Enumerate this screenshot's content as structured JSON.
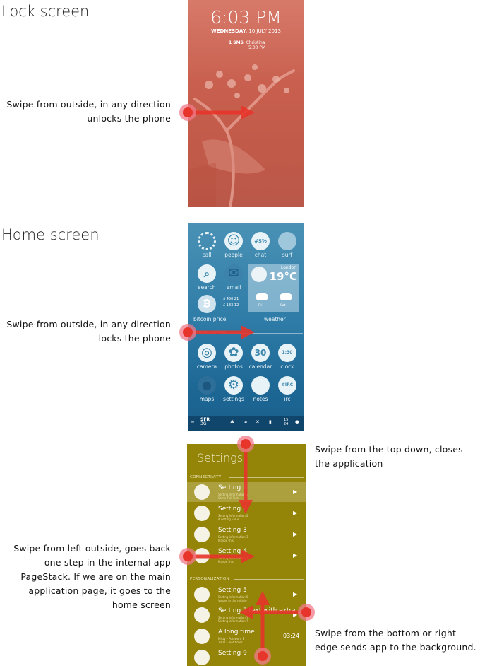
{
  "headings": {
    "lock": "Lock screen",
    "home": "Home screen"
  },
  "notes": {
    "lock": [
      "Swipe from outside, in any direction",
      "unlocks the phone"
    ],
    "home": [
      "Swipe from outside, in any direction",
      "locks the phone"
    ],
    "top": [
      "Swipe from the top down, closes",
      "the application"
    ],
    "left": [
      "Swipe from left outside, goes back",
      "one step in the internal app",
      "PageStack. If we are on the main",
      "application page, it goes to the",
      "home screen"
    ],
    "bottom": [
      "Swipe from the bottom or right",
      "edge sends app to the background."
    ]
  },
  "lock_screen": {
    "time": "6:03 PM",
    "date_day": "WEDNESDAY,",
    "date_rest": " 10 JULY 2013",
    "notification_label": "1 SMS",
    "notification_name": "Christina",
    "notification_time": "5:00 PM"
  },
  "home_screen": {
    "apps_row1": [
      {
        "label": "call",
        "icon": "call-icon",
        "glyph": ""
      },
      {
        "label": "people",
        "icon": "smiley-icon",
        "glyph": "☺"
      },
      {
        "label": "chat",
        "icon": "chat-icon",
        "glyph": "#$%"
      },
      {
        "label": "surf",
        "icon": "globe-icon",
        "glyph": ""
      }
    ],
    "apps_row2": [
      {
        "label": "search",
        "icon": "search-icon",
        "glyph": "⌕"
      },
      {
        "label": "email",
        "icon": "email-icon",
        "glyph": "✉"
      }
    ],
    "bitcoin": {
      "label": "bitcoin price",
      "icon": "bitcoin-icon",
      "glyph": "₿",
      "usd": "$ 450.21",
      "gbp": "£ 133.12"
    },
    "weather": {
      "label": "weather",
      "city": "London",
      "temp": "19°C",
      "day1": "Fri",
      "day2": "Sat"
    },
    "section_label": "PERSONALIZATION",
    "apps_row4": [
      {
        "label": "camera",
        "icon": "camera-icon",
        "glyph": "◎"
      },
      {
        "label": "photos",
        "icon": "flower-icon",
        "glyph": "✿"
      },
      {
        "label": "calendar",
        "icon": "calendar-icon",
        "glyph": "30"
      },
      {
        "label": "clock",
        "icon": "clock-icon",
        "glyph": "1:30"
      }
    ],
    "apps_row5": [
      {
        "label": "maps",
        "icon": "map-pin-icon",
        "glyph": "●"
      },
      {
        "label": "settings",
        "icon": "gear-icon",
        "glyph": "⚙"
      },
      {
        "label": "notes",
        "icon": "notes-icon",
        "glyph": ""
      },
      {
        "label": "irc",
        "icon": "irc-icon",
        "glyph": "#IRC"
      }
    ],
    "status": {
      "carrier": "SFR",
      "carrier_sub": "3G",
      "time": "15",
      "time_sub": "24"
    }
  },
  "settings_app": {
    "title": "Settings",
    "section1": "CONNECTIVITY",
    "section2": "PERSONALIZATION",
    "rows_top": [
      {
        "title": "Setting 1",
        "sub1": "Setting information 1",
        "sub2": "Some Full Text",
        "highlight": true
      },
      {
        "title": "Setting 2",
        "sub1": "Setting information 2",
        "sub2": "A setting value",
        "highlight": false
      },
      {
        "title": "Setting 3",
        "sub1": "Setting information 3",
        "sub2": "Maybe this",
        "highlight": false
      },
      {
        "title": "Setting 4",
        "sub1": "Setting information 4",
        "sub2": "Maybe this",
        "highlight": false
      }
    ],
    "rows_bottom": [
      {
        "title": "Setting 5",
        "sub1": "Setting information 5",
        "sub2": "Values in the middle",
        "right": "▶"
      },
      {
        "title": "Setting 7 text with extra",
        "sub1": "Setting information 7",
        "sub2": "Setting information 7",
        "right": "▶"
      },
      {
        "title": "A long time",
        "sub1": "Misty – Potsword B",
        "sub2": "2000 – alot times",
        "right": "03:24"
      },
      {
        "title": "Setting 9",
        "sub1": "",
        "sub2": "",
        "right": ""
      }
    ],
    "arrow_glyph": "▶"
  },
  "colors": {
    "lock_bg": "#c9604f",
    "home_bg": "#2f7da8",
    "settings_bg": "#948408",
    "gesture_red": "#e8352b",
    "gesture_pink": "#f07a8a"
  }
}
